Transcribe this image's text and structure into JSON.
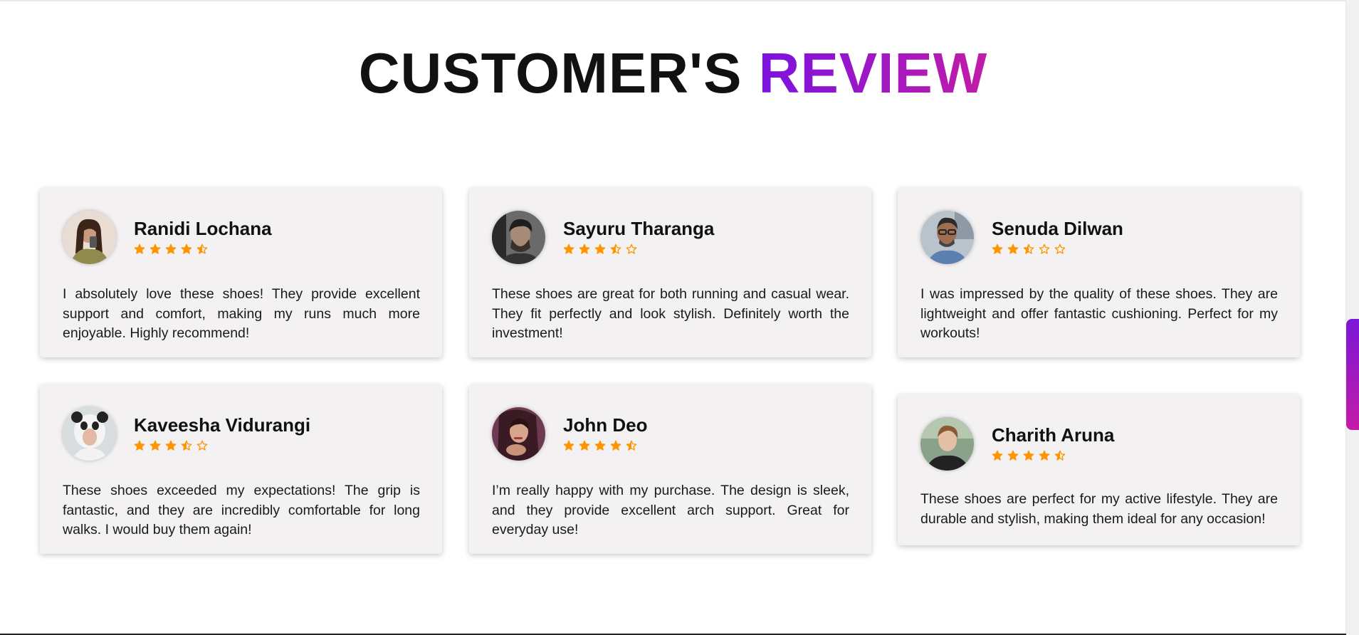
{
  "heading": {
    "part1": "CUSTOMER'S",
    "part2": "REVIEW"
  },
  "colors": {
    "accent_start": "#7b12e0",
    "accent_end": "#c21ca8",
    "star": "#ff9500",
    "card_bg": "#f3f1f2"
  },
  "reviews": [
    {
      "name": "Ranidi Lochana",
      "rating": 4.5,
      "avatar": "woman-with-phone-photo",
      "text": "I absolutely love these shoes! They provide excellent support and comfort, making my runs much more enjoyable. Highly recommend!"
    },
    {
      "name": "Sayuru Tharanga",
      "rating": 3.5,
      "avatar": "bearded-man-photo",
      "text": "These shoes are great for both running and casual wear. They fit perfectly and look stylish. Definitely worth the investment!"
    },
    {
      "name": "Senuda Dilwan",
      "rating": 2.5,
      "avatar": "smiling-man-glasses-photo",
      "text": "I was impressed by the quality of these shoes. They are lightweight and offer fantastic cushioning. Perfect for my workouts!"
    },
    {
      "name": "Kaveesha Vidurangi",
      "rating": 3.5,
      "avatar": "panda-hood-girl-photo",
      "text": "These shoes exceeded my expectations! The grip is fantastic, and they are incredibly comfortable for long walks. I would buy them again!"
    },
    {
      "name": "John Deo",
      "rating": 4.5,
      "avatar": "woman-portrait-photo",
      "text": "I’m really happy with my purchase. The design is sleek, and they provide excellent arch support. Great for everyday use!"
    },
    {
      "name": "Charith Aruna",
      "rating": 4.5,
      "avatar": "young-man-photo",
      "text": "These shoes are perfect for my active lifestyle. They are durable and stylish, making them ideal for any occasion!"
    }
  ]
}
